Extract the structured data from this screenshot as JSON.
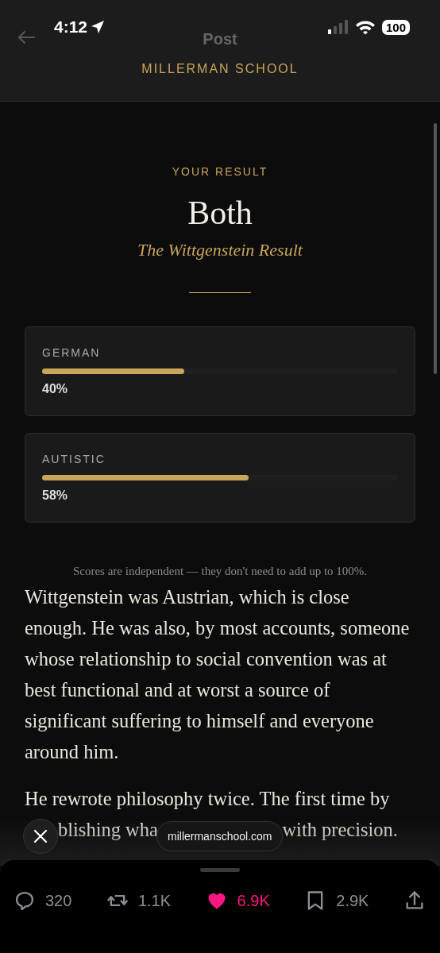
{
  "status_bar": {
    "time": "4:12",
    "battery": "100"
  },
  "nav": {
    "title": "Post"
  },
  "header": {
    "brand": "MILLERMAN SCHOOL"
  },
  "result": {
    "eyebrow": "YOUR RESULT",
    "title": "Both",
    "subtitle": "The Wittgenstein Result"
  },
  "scores": [
    {
      "label": "GERMAN",
      "level": 0.4,
      "value": "40%"
    },
    {
      "label": "AUTISTIC",
      "level": 0.58,
      "value": "58%"
    }
  ],
  "note": "Scores are independent — they don't need to add up to 100%.",
  "paragraphs": [
    "Wittgenstein was Austrian, which is close enough. He was also, by most accounts, someone whose relationship to social convention was at best functional and at worst a source of significant suffering to himself and everyone around him."
  ],
  "partial_paragraph": {
    "first_line": "He rewrote philosophy twice. The first time by",
    "fragments": [
      "blishing wha",
      "with precision."
    ]
  },
  "url_pill": "millermanschool.com",
  "actions": [
    {
      "kind": "reply",
      "count": "320",
      "selected": false
    },
    {
      "kind": "repost",
      "count": "1.1K",
      "selected": false
    },
    {
      "kind": "like",
      "count": "6.9K",
      "selected": true
    },
    {
      "kind": "bookmark",
      "count": "2.9K",
      "selected": false
    },
    {
      "kind": "share",
      "selected": false
    }
  ]
}
